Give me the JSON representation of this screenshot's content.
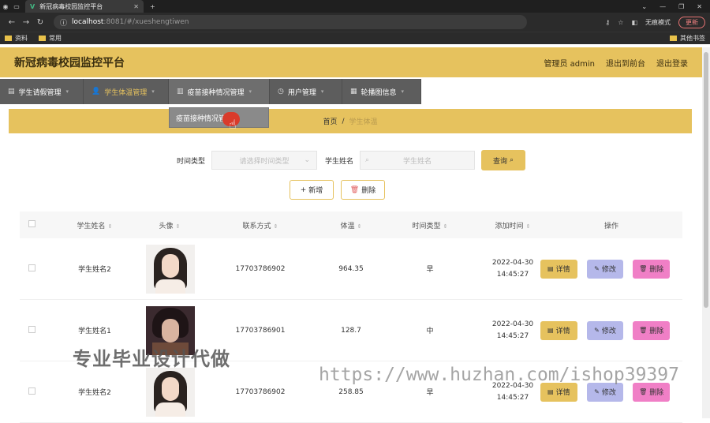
{
  "browser": {
    "tab_title": "新冠病毒校园监控平台",
    "url_host": "localhost",
    "url_path": ":8081/#/xueshengtiwen",
    "incognito_label": "无痕模式",
    "update_label": "更新",
    "bookmarks": [
      "资料",
      "常用"
    ],
    "other_bookmarks": "其他书签"
  },
  "header": {
    "title": "新冠病毒校园监控平台",
    "admin_label": "管理员 admin",
    "back_front": "退出到前台",
    "logout": "退出登录"
  },
  "menu": {
    "items": [
      {
        "label": "学生请假管理"
      },
      {
        "label": "学生体温管理"
      },
      {
        "label": "疫苗接种情况管理"
      },
      {
        "label": "用户管理"
      },
      {
        "label": "轮播图信息"
      }
    ],
    "dropdown_item": "疫苗接种情况管理"
  },
  "breadcrumb": {
    "home": "首页",
    "separator": "/",
    "current": "学生体温"
  },
  "search": {
    "type_label": "时间类型",
    "type_placeholder": "请选择时间类型",
    "name_label": "学生姓名",
    "name_placeholder": "学生姓名",
    "query_label": "查询"
  },
  "actions": {
    "add_label": "新增",
    "delete_label": "删除"
  },
  "table": {
    "headers": {
      "name": "学生姓名",
      "avatar": "头像",
      "phone": "联系方式",
      "temperature": "体温",
      "time_type": "时间类型",
      "added_time": "添加时间",
      "ops": "操作"
    },
    "rows": [
      {
        "name": "学生姓名2",
        "phone": "17703786902",
        "temperature": "964.35",
        "time_type": "早",
        "added_time": "2022-04-30 14:45:27"
      },
      {
        "name": "学生姓名1",
        "phone": "17703786901",
        "temperature": "128.7",
        "time_type": "中",
        "added_time": "2022-04-30 14:45:27"
      },
      {
        "name": "学生姓名2",
        "phone": "17703786902",
        "temperature": "258.85",
        "time_type": "早",
        "added_time": "2022-04-30 14:45:27"
      }
    ],
    "op_labels": {
      "detail": "详情",
      "edit": "修改",
      "delete": "删除"
    }
  },
  "watermarks": {
    "left": "专业毕业设计代做",
    "right": "https://www.huzhan.com/ishop39397"
  },
  "colors": {
    "accent": "#e6c25e",
    "menu_bg": "#5d5d5d",
    "edit_btn": "#b5b8ea",
    "delete_btn": "#f07fc6"
  }
}
